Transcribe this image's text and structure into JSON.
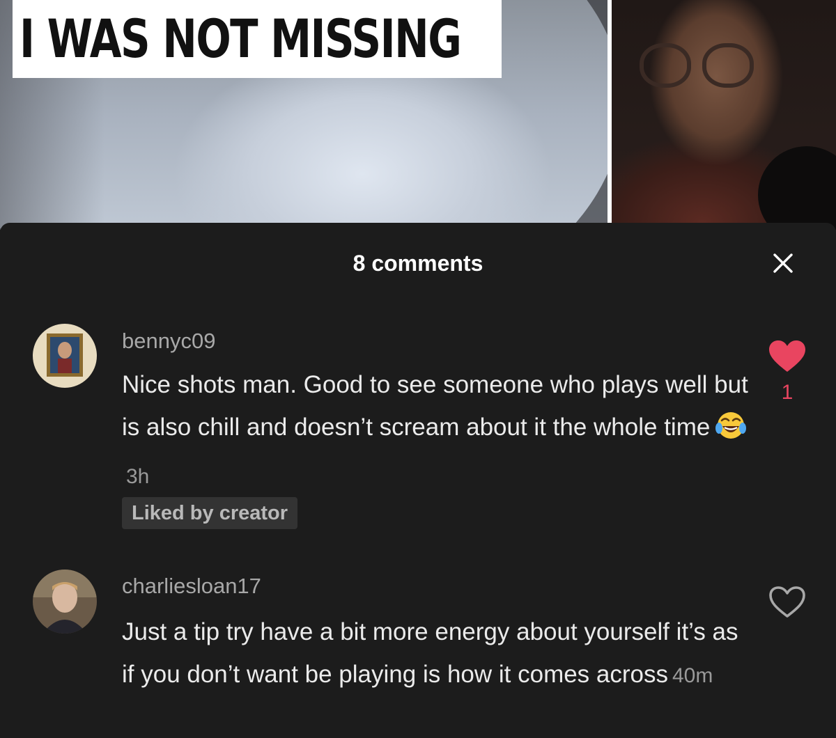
{
  "video": {
    "title_card": "I WAS NOT MISSING"
  },
  "comments_sheet": {
    "title": "8 comments",
    "close_icon": "close-icon",
    "comments": [
      {
        "username": "bennyc09",
        "text": "Nice shots man. Good to see someone who plays well but is also chill and doesn’t scream about it the whole time",
        "emoji": "😂",
        "time": "3h",
        "badge": "Liked by creator",
        "like_count": "1",
        "liked": true
      },
      {
        "username": "charliesloan17",
        "text": "Just a tip try have a bit more energy about yourself it’s as if you don’t want be playing is how it comes across",
        "time": "40m",
        "liked": false
      }
    ]
  },
  "colors": {
    "sheet_bg": "#1c1c1c",
    "like_accent": "#e94560",
    "username": "#a8a8a8",
    "text": "#ebebeb",
    "badge_bg": "#333333"
  }
}
